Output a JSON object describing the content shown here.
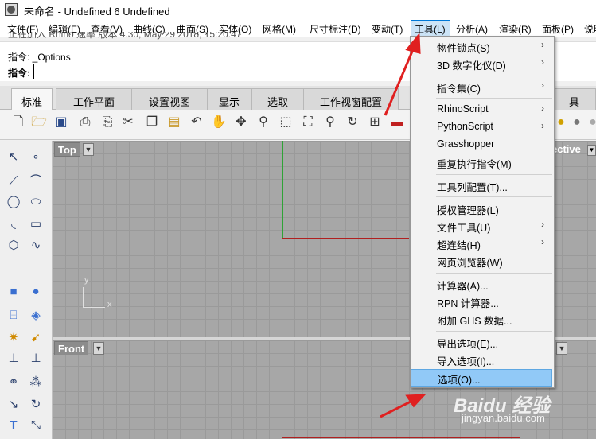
{
  "window": {
    "title": "未命名 - Undefined 6 Undefined"
  },
  "menubar": {
    "items": [
      {
        "label": "文件(F)"
      },
      {
        "label": "编辑(E)"
      },
      {
        "label": "查看(V)"
      },
      {
        "label": "曲线(C)"
      },
      {
        "label": "曲面(S)"
      },
      {
        "label": "实体(O)"
      },
      {
        "label": "网格(M)"
      },
      {
        "label": "尺寸标注(D)"
      },
      {
        "label": "变动(T)"
      },
      {
        "label": "工具(L)"
      },
      {
        "label": "分析(A)"
      },
      {
        "label": "渲染(R)"
      },
      {
        "label": "面板(P)"
      },
      {
        "label": "说明"
      }
    ],
    "active_index": 9
  },
  "command": {
    "history_partial": "正在加入 Rhino 速率 版本 4.30, May 29 2018, 15:20:47",
    "prompt1": "指令: _Options",
    "prompt2_label": "指令:",
    "input_value": ""
  },
  "tabs": [
    {
      "label": "标准",
      "active": true
    },
    {
      "label": "工作平面"
    },
    {
      "label": "设置视图"
    },
    {
      "label": "显示"
    },
    {
      "label": "选取"
    },
    {
      "label": "工作视窗配置"
    },
    {
      "label": "具"
    }
  ],
  "toolbar": {
    "icons": [
      "new-file-icon",
      "open-folder-icon",
      "save-icon",
      "print-icon",
      "import-icon",
      "cut-icon",
      "copy-icon",
      "paste-icon",
      "undo-icon",
      "pan-hand-icon",
      "rotate-view-icon",
      "zoom-icon",
      "zoom-window-icon",
      "zoom-extents-icon",
      "zoom-selected-icon",
      "zoom-dynamic-icon",
      "viewport-layout-icon",
      "car-icon",
      "sphere-icon",
      "shaded-sphere-icon",
      "rendered-sphere-icon"
    ]
  },
  "sidebar": {
    "icons": [
      "select-arrow-icon",
      "point-icon",
      "polyline-icon",
      "curve-pts-icon",
      "circle-icon",
      "ellipse-icon",
      "arc-icon",
      "rectangle-icon",
      "polygon-icon",
      "free-curve-icon",
      "box-icon",
      "sphere-solid-icon",
      "surface-icon",
      "extrude-icon",
      "cylinder-icon",
      "lofted-icon",
      "gear-icon",
      "arrow-tool-icon",
      "move-icon",
      "boolean-icon",
      "group-icon",
      "points-icon",
      "fillet-icon",
      "blend-icon",
      "text-icon",
      "transform-icon"
    ]
  },
  "viewports": {
    "top": {
      "label": "Top",
      "axis_x": "x",
      "axis_y": "y"
    },
    "front": {
      "label": "Front"
    },
    "perspective": {
      "label": "ective"
    }
  },
  "dropdown": {
    "items": [
      {
        "label": "物件锁点(S)",
        "submenu": true
      },
      {
        "label": "3D 数字化仪(D)",
        "submenu": true
      },
      {
        "separator": true
      },
      {
        "label": "指令集(C)",
        "submenu": true
      },
      {
        "separator": true
      },
      {
        "label": "RhinoScript",
        "submenu": true
      },
      {
        "label": "PythonScript",
        "submenu": true
      },
      {
        "label": "Grasshopper"
      },
      {
        "label": "重复执行指令(M)"
      },
      {
        "separator": true
      },
      {
        "label": "工具列配置(T)..."
      },
      {
        "separator": true
      },
      {
        "label": "授权管理器(L)"
      },
      {
        "label": "文件工具(U)",
        "submenu": true
      },
      {
        "label": "超连结(H)",
        "submenu": true
      },
      {
        "label": "网页浏览器(W)"
      },
      {
        "separator": true
      },
      {
        "label": "计算器(A)..."
      },
      {
        "label": "RPN 计算器..."
      },
      {
        "label": "附加 GHS 数据..."
      },
      {
        "separator": true
      },
      {
        "label": "导出选项(E)..."
      },
      {
        "label": "导入选项(I)..."
      },
      {
        "label": "选项(O)...",
        "highlighted": true
      }
    ],
    "arrow_glyph": "›"
  },
  "watermark": {
    "logo": "Baidu 经验",
    "url": "jingyan.baidu.com"
  },
  "colors": {
    "viewport_bg": "#a7a7a7",
    "axis_green": "#2fa336",
    "axis_red": "#b02020",
    "highlight": "#91c9f7",
    "annotation_red": "#e02020"
  }
}
